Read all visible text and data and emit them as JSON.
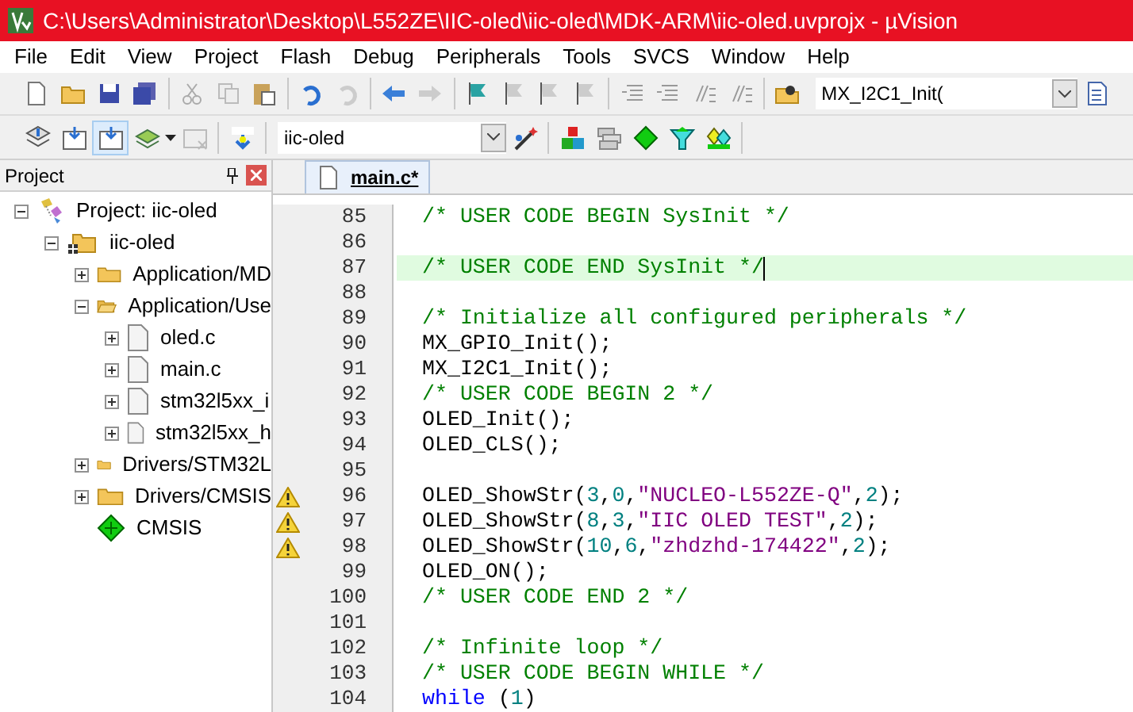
{
  "window": {
    "title": "C:\\Users\\Administrator\\Desktop\\L552ZE\\IIC-oled\\iic-oled\\MDK-ARM\\iic-oled.uvprojx - µVision"
  },
  "menu": [
    "File",
    "Edit",
    "View",
    "Project",
    "Flash",
    "Debug",
    "Peripherals",
    "Tools",
    "SVCS",
    "Window",
    "Help"
  ],
  "toolbar": {
    "find_field": {
      "value": "MX_I2C1_Init("
    },
    "target_select": {
      "value": "iic-oled"
    }
  },
  "project_panel": {
    "title": "Project",
    "tree": [
      {
        "label": "Project: iic-oled",
        "kind": "project",
        "expanded": true,
        "children": [
          {
            "label": "iic-oled",
            "kind": "target",
            "expanded": true,
            "children": [
              {
                "label": "Application/MD",
                "kind": "folder",
                "expanded": false
              },
              {
                "label": "Application/Use",
                "kind": "folder",
                "expanded": true,
                "children": [
                  {
                    "label": "oled.c",
                    "kind": "file",
                    "expanded": false
                  },
                  {
                    "label": "main.c",
                    "kind": "file",
                    "expanded": false
                  },
                  {
                    "label": "stm32l5xx_i",
                    "kind": "file",
                    "expanded": false
                  },
                  {
                    "label": "stm32l5xx_h",
                    "kind": "file",
                    "expanded": false
                  }
                ]
              },
              {
                "label": "Drivers/STM32L",
                "kind": "folder",
                "expanded": false
              },
              {
                "label": "Drivers/CMSIS",
                "kind": "folder",
                "expanded": false
              },
              {
                "label": "CMSIS",
                "kind": "component"
              }
            ]
          }
        ]
      }
    ]
  },
  "editor": {
    "tabs": [
      {
        "label": "main.c*",
        "selected": true
      }
    ],
    "lines": [
      {
        "number": "85",
        "current": false,
        "warning": false,
        "segments": [
          {
            "kind": "comment",
            "text": "/* USER CODE BEGIN SysInit */"
          }
        ]
      },
      {
        "number": "86",
        "current": false,
        "warning": false
      },
      {
        "number": "87",
        "current": true,
        "warning": false,
        "segments": [
          {
            "kind": "comment",
            "text": "/* USER CODE END SysInit */"
          }
        ]
      },
      {
        "number": "88",
        "current": false,
        "warning": false
      },
      {
        "number": "89",
        "current": false,
        "warning": false,
        "segments": [
          {
            "kind": "comment",
            "text": "/* Initialize all configured peripherals */"
          }
        ]
      },
      {
        "number": "90",
        "current": false,
        "warning": false,
        "segments": [
          {
            "kind": "plain",
            "text": "MX_GPIO_Init();"
          }
        ]
      },
      {
        "number": "91",
        "current": false,
        "warning": false,
        "segments": [
          {
            "kind": "plain",
            "text": "MX_I2C1_Init();"
          }
        ]
      },
      {
        "number": "92",
        "current": false,
        "warning": false,
        "segments": [
          {
            "kind": "comment",
            "text": "/* USER CODE BEGIN 2 */"
          }
        ]
      },
      {
        "number": "93",
        "current": false,
        "warning": false,
        "segments": [
          {
            "kind": "plain",
            "text": "OLED_Init();"
          }
        ]
      },
      {
        "number": "94",
        "current": false,
        "warning": false,
        "segments": [
          {
            "kind": "plain",
            "text": "OLED_CLS();"
          }
        ]
      },
      {
        "number": "95",
        "current": false,
        "warning": false
      },
      {
        "number": "96",
        "current": false,
        "warning": true,
        "segments": [
          {
            "kind": "plain",
            "text": "OLED_ShowStr("
          },
          {
            "kind": "number",
            "text": "3"
          },
          {
            "kind": "plain",
            "text": ","
          },
          {
            "kind": "number",
            "text": "0"
          },
          {
            "kind": "plain",
            "text": ","
          },
          {
            "kind": "string",
            "text": "\"NUCLEO-L552ZE-Q\""
          },
          {
            "kind": "plain",
            "text": ","
          },
          {
            "kind": "number",
            "text": "2"
          },
          {
            "kind": "plain",
            "text": ");"
          }
        ]
      },
      {
        "number": "97",
        "current": false,
        "warning": true,
        "segments": [
          {
            "kind": "plain",
            "text": "OLED_ShowStr("
          },
          {
            "kind": "number",
            "text": "8"
          },
          {
            "kind": "plain",
            "text": ","
          },
          {
            "kind": "number",
            "text": "3"
          },
          {
            "kind": "plain",
            "text": ","
          },
          {
            "kind": "string",
            "text": "\"IIC OLED TEST\""
          },
          {
            "kind": "plain",
            "text": ","
          },
          {
            "kind": "number",
            "text": "2"
          },
          {
            "kind": "plain",
            "text": ");"
          }
        ]
      },
      {
        "number": "98",
        "current": false,
        "warning": true,
        "segments": [
          {
            "kind": "plain",
            "text": "OLED_ShowStr("
          },
          {
            "kind": "number",
            "text": "10"
          },
          {
            "kind": "plain",
            "text": ","
          },
          {
            "kind": "number",
            "text": "6"
          },
          {
            "kind": "plain",
            "text": ","
          },
          {
            "kind": "string",
            "text": "\"zhdzhd-174422\""
          },
          {
            "kind": "plain",
            "text": ","
          },
          {
            "kind": "number",
            "text": "2"
          },
          {
            "kind": "plain",
            "text": ");"
          }
        ]
      },
      {
        "number": "99",
        "current": false,
        "warning": false,
        "segments": [
          {
            "kind": "plain",
            "text": "OLED_ON();"
          }
        ]
      },
      {
        "number": "100",
        "current": false,
        "warning": false,
        "segments": [
          {
            "kind": "comment",
            "text": "/* USER CODE END 2 */"
          }
        ]
      },
      {
        "number": "101",
        "current": false,
        "warning": false
      },
      {
        "number": "102",
        "current": false,
        "warning": false,
        "segments": [
          {
            "kind": "comment",
            "text": "/* Infinite loop */"
          }
        ]
      },
      {
        "number": "103",
        "current": false,
        "warning": false,
        "segments": [
          {
            "kind": "comment",
            "text": "/* USER CODE BEGIN WHILE */"
          }
        ]
      },
      {
        "number": "104",
        "current": false,
        "warning": false,
        "segments": [
          {
            "kind": "keyword",
            "text": "while"
          },
          {
            "kind": "plain",
            "text": " ("
          },
          {
            "kind": "number",
            "text": "1"
          },
          {
            "kind": "plain",
            "text": ")"
          }
        ]
      }
    ]
  }
}
